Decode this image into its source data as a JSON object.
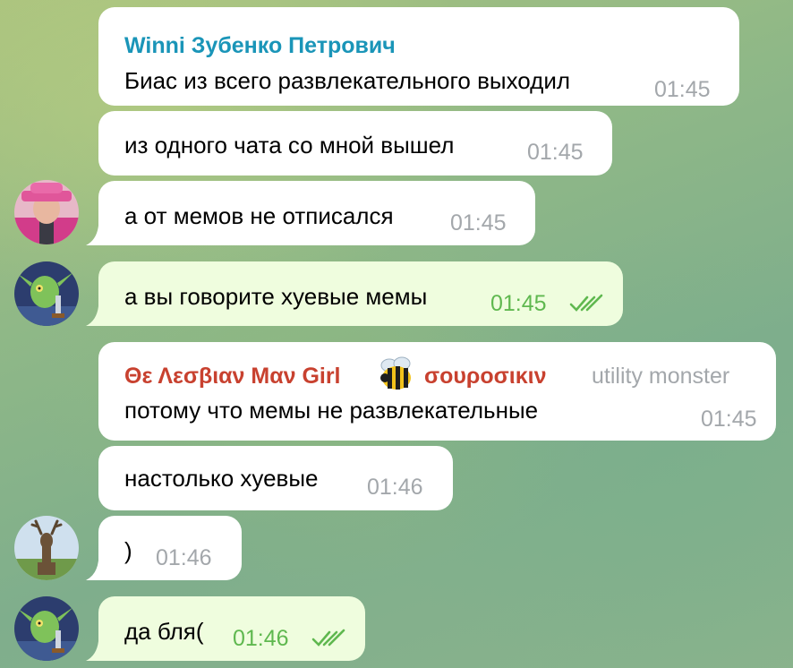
{
  "messages": [
    {
      "sender": "Winni Зубенко Петрович",
      "sender_color": "#1a95b8",
      "text": "Биас из всего развлекательного выходил",
      "time": "01:45"
    },
    {
      "text": "из одного чата со мной вышел",
      "time": "01:45"
    },
    {
      "text": "а от мемов не отписался",
      "time": "01:45",
      "avatar": "pink-hat-avatar"
    },
    {
      "text": "а вы говорите хуевые мемы",
      "time": "01:45",
      "outgoing": true,
      "status": "read",
      "avatar": "goblin-avatar"
    },
    {
      "sender_part1": "Θε Λεσβιαν Μαν Girl",
      "sender_emoji": "bee-emoji",
      "sender_part2": "σουροσικιν",
      "sender_color": "#c8412f",
      "rank": "utility monster",
      "text": "потому что мемы не развлекательные",
      "time": "01:45"
    },
    {
      "text": "настолько хуевые",
      "time": "01:46"
    },
    {
      "text": ")",
      "time": "01:46",
      "avatar": "deer-avatar"
    },
    {
      "text": "да бля(",
      "time": "01:46",
      "outgoing": true,
      "status": "read",
      "avatar": "goblin-avatar"
    }
  ],
  "colors": {
    "outgoing_bubble": "#effdde",
    "incoming_bubble": "#ffffff",
    "read_tick": "#5fb84f",
    "time": "#a3a7ab"
  }
}
